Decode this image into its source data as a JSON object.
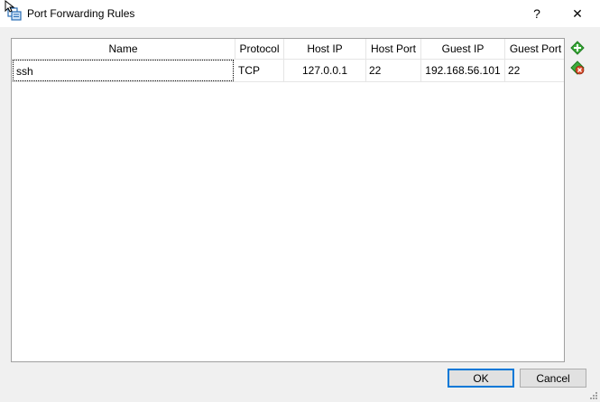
{
  "window": {
    "title": "Port Forwarding Rules",
    "help_label": "?",
    "close_label": "✕"
  },
  "table": {
    "columns": [
      "Name",
      "Protocol",
      "Host IP",
      "Host Port",
      "Guest IP",
      "Guest Port"
    ],
    "rows": [
      {
        "name": "ssh",
        "protocol": "TCP",
        "host_ip": "127.0.0.1",
        "host_port": "22",
        "guest_ip": "192.168.56.101",
        "guest_port": "22"
      }
    ]
  },
  "side_buttons": {
    "add_icon": "add-rule-icon",
    "remove_icon": "remove-rule-icon"
  },
  "buttons": {
    "ok_label": "OK",
    "cancel_label": "Cancel"
  },
  "colors": {
    "focus_border": "#0078d7",
    "add_green": "#3cab3c",
    "remove_red": "#d94c2a"
  }
}
